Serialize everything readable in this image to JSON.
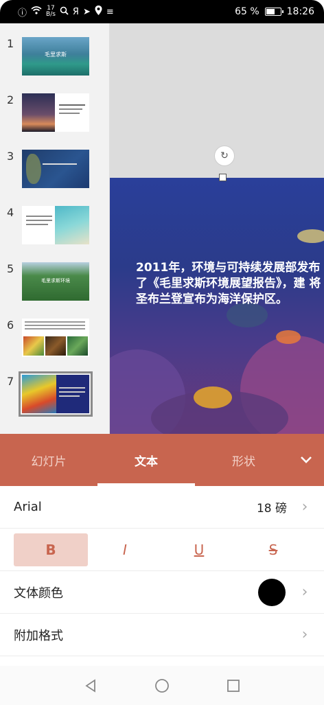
{
  "status": {
    "net_speed_value": "17",
    "net_speed_unit": "B/s",
    "battery_text": "65 %",
    "battery_level": 0.65,
    "time": "18:26"
  },
  "thumbnails": [
    {
      "num": "1",
      "caption": "毛里求斯"
    },
    {
      "num": "2",
      "caption": ""
    },
    {
      "num": "3",
      "caption": ""
    },
    {
      "num": "4",
      "caption": ""
    },
    {
      "num": "5",
      "caption": "毛里求斯环境"
    },
    {
      "num": "6",
      "caption": ""
    },
    {
      "num": "7",
      "caption": ""
    }
  ],
  "slide": {
    "text": "2011年，环境与可持续发展部发布了《毛里求斯环境展望报告》，建  将圣布兰登宣布为海洋保护区。"
  },
  "tabs": [
    {
      "label": "幻灯片"
    },
    {
      "label": "文本"
    },
    {
      "label": "形状"
    }
  ],
  "text_panel": {
    "font_name": "Arial",
    "font_size": "18 磅",
    "bold": "B",
    "italic": "I",
    "underline": "U",
    "strike": "S",
    "color_label": "文体颜色",
    "extra_label": "附加格式"
  },
  "colors": {
    "accent": "#c8654f",
    "text_color_swatch": "#000000"
  }
}
